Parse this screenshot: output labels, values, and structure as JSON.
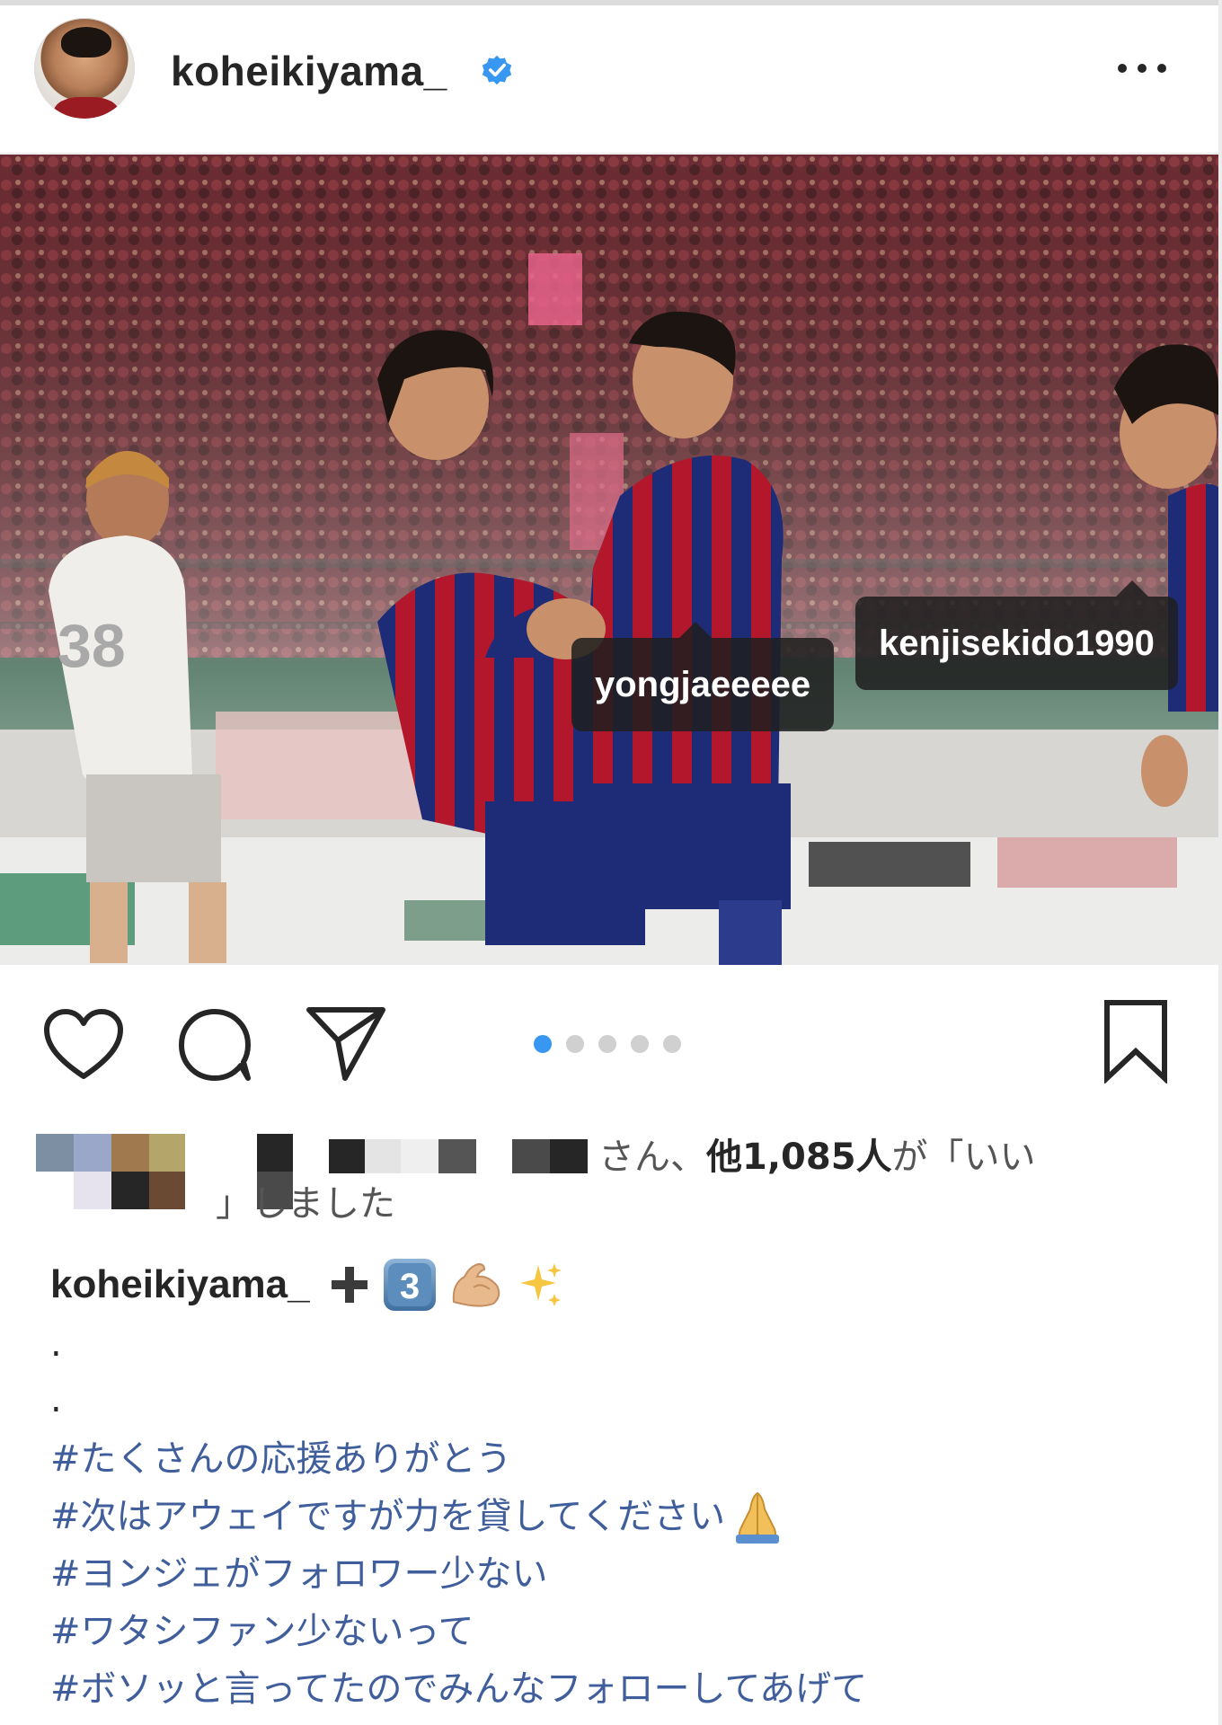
{
  "post": {
    "username": "koheikiyama_",
    "verified": true,
    "more_label": "•••"
  },
  "photo": {
    "description_icon": "photo-soccer-celebration",
    "tags": [
      {
        "name": "yongjaeeeee"
      },
      {
        "name": "kenjisekido1990"
      }
    ]
  },
  "carousel": {
    "total": 5,
    "active_index": 0,
    "active_color": "#3897f0"
  },
  "likes": {
    "line1_suffix": "さん、",
    "count_text": "他1,085人",
    "line1_tail": "が「いい",
    "line2": "」しました"
  },
  "caption": {
    "username": "koheikiyama_",
    "emojis": [
      "heavy-plus-icon",
      "keycap-3-icon",
      "flexed-biceps-icon",
      "sparkles-icon"
    ],
    "dots": [
      ".",
      "."
    ],
    "hashtags": [
      "#たくさんの応援ありがとう",
      "#次はアウェイですが力を貸してください",
      "#ヨンジェがフォロワー少ない",
      "#ワタシファン少ないって",
      "#ボソッと言ってたのでみんなフォローしてあげて"
    ]
  },
  "colors": {
    "verified_blue": "#3897f0",
    "hashtag_blue": "#3f5e9b",
    "text_dark": "#262626"
  }
}
